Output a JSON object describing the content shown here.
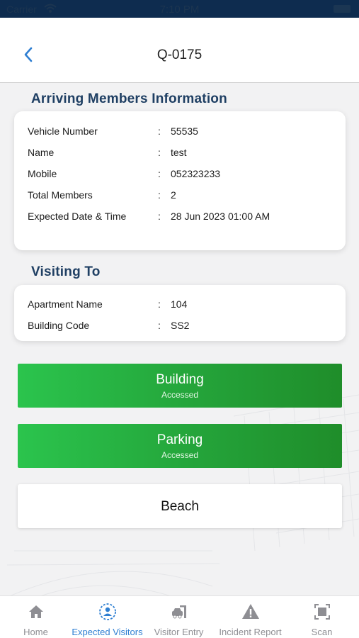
{
  "status_bar": {
    "carrier": "Carrier",
    "time": "7:10 PM"
  },
  "header": {
    "title": "Q-0175",
    "back_icon": "chevron-left-icon"
  },
  "arriving": {
    "title": "Arriving Members Information",
    "rows": [
      {
        "label": "Vehicle Number",
        "value": "55535"
      },
      {
        "label": "Name",
        "value": "test"
      },
      {
        "label": "Mobile",
        "value": "052323233"
      },
      {
        "label": "Total Members",
        "value": "2"
      },
      {
        "label": "Expected Date & Time",
        "value": "28 Jun 2023 01:00 AM"
      }
    ]
  },
  "visiting": {
    "title": "Visiting To",
    "rows": [
      {
        "label": "Apartment Name",
        "value": "104"
      },
      {
        "label": "Building Code",
        "value": "SS2"
      }
    ]
  },
  "separator": ":",
  "access": {
    "building": {
      "label": "Building",
      "status": "Accessed",
      "color": "#26a83c"
    },
    "parking": {
      "label": "Parking",
      "status": "Accessed",
      "color": "#26a83c"
    },
    "beach": {
      "label": "Beach"
    }
  },
  "tabs": [
    {
      "label": "Home",
      "icon": "home-icon",
      "active": false
    },
    {
      "label": "Expected Visitors",
      "icon": "expected-visitors-icon",
      "active": true
    },
    {
      "label": "Visitor Entry",
      "icon": "car-entry-icon",
      "active": false
    },
    {
      "label": "Incident Report",
      "icon": "warning-icon",
      "active": false
    },
    {
      "label": "Scan",
      "icon": "scan-icon",
      "active": false
    }
  ],
  "colors": {
    "accent": "#2f7fd2",
    "title": "#1f3f63",
    "status_bar": "#0e2c4f"
  }
}
